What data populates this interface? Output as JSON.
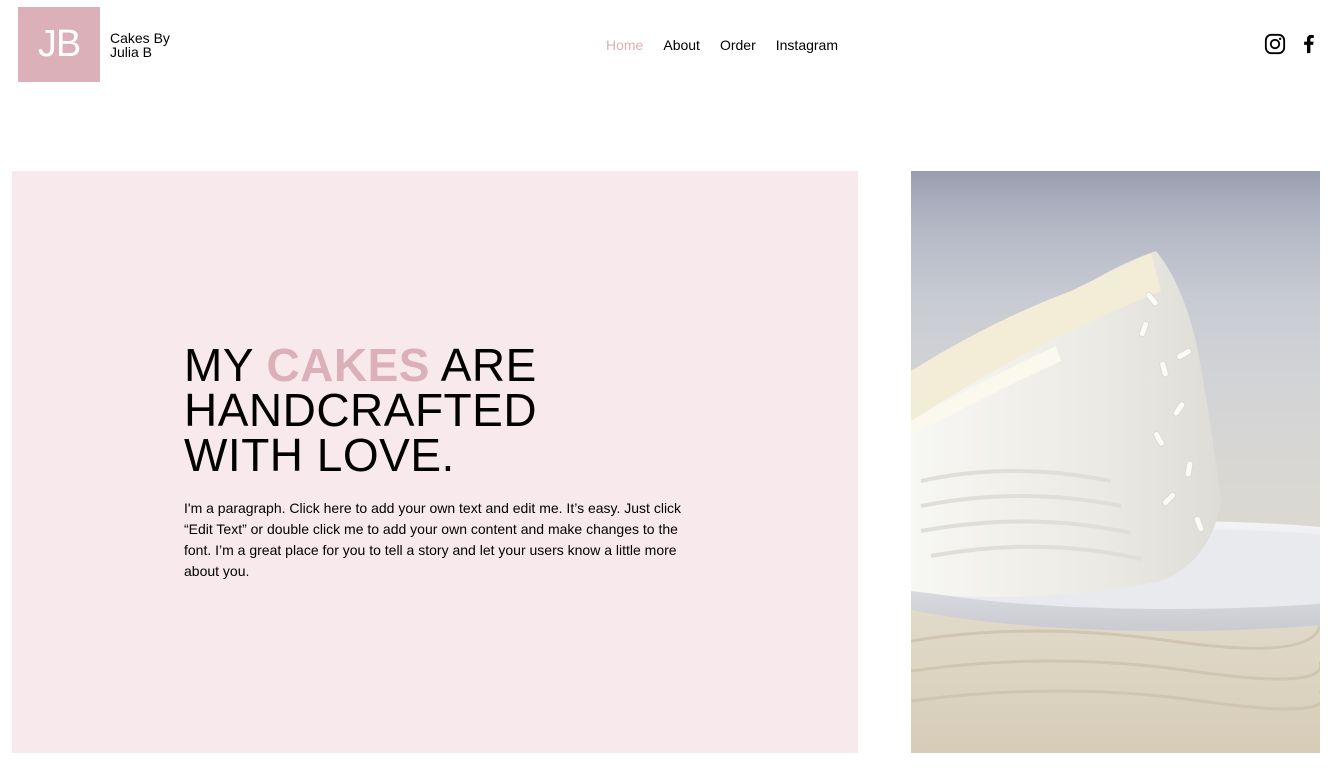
{
  "brand": {
    "logo_initials": "JB",
    "name": "Cakes By Julia B",
    "accent_color": "#dcb0b8",
    "panel_color": "#f8e9ec"
  },
  "nav": {
    "items": [
      {
        "label": "Home",
        "active": true
      },
      {
        "label": "About",
        "active": false
      },
      {
        "label": "Order",
        "active": false
      },
      {
        "label": "Instagram",
        "active": false
      }
    ]
  },
  "social": {
    "icons": [
      "instagram-icon",
      "facebook-icon"
    ]
  },
  "hero": {
    "headline_part1": "MY ",
    "headline_accent": "CAKES",
    "headline_part2": " ARE",
    "headline_line2": "HANDCRAFTED",
    "headline_line3": "WITH LOVE.",
    "paragraph": "I'm a paragraph. Click here to add your own text and edit me. It’s easy. Just click “Edit Text” or double click me to add your own content and make changes to the font. I’m a great place for you to tell a story and let your users know a little more about you."
  }
}
